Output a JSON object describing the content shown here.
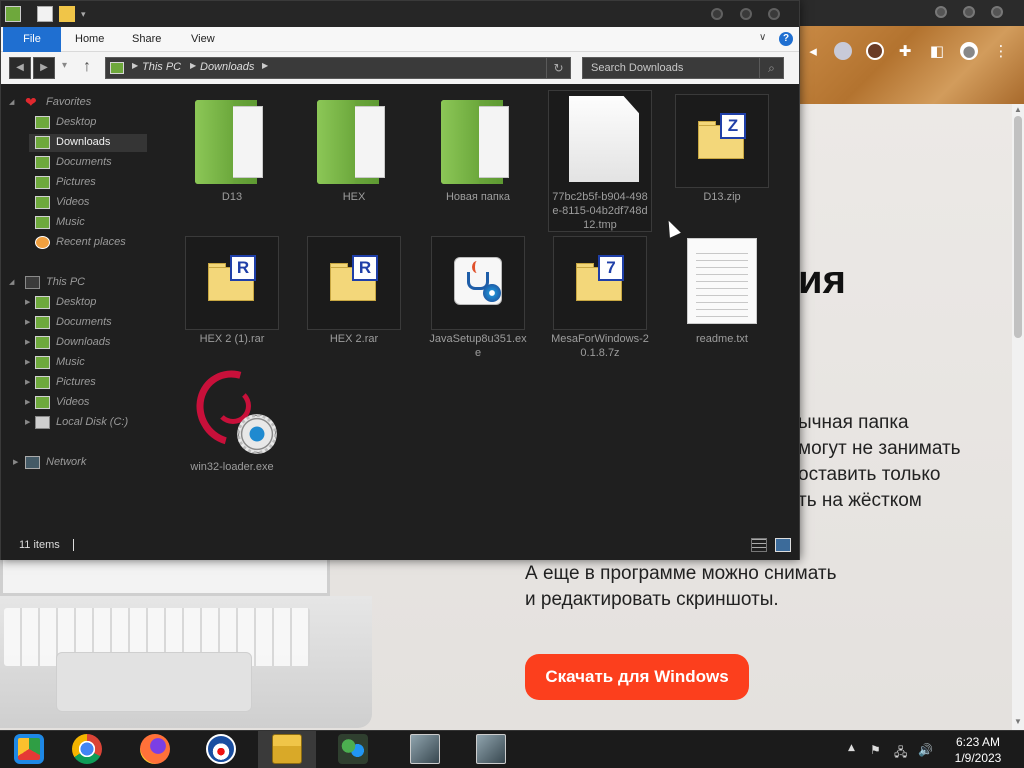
{
  "browser": {
    "heading_fragment": "ия",
    "paragraph_lines": [
      "ычная папка",
      "могут не занимать",
      "оставить только",
      "ть на жёстком"
    ],
    "paragraph2_lines": [
      "А еще в программе можно снимать",
      "и редактировать скриншоты."
    ],
    "download_button": "Скачать для Windows",
    "accent_color": "#fc3f1d"
  },
  "explorer": {
    "ribbon_tabs": [
      "File",
      "Home",
      "Share",
      "View"
    ],
    "address": {
      "crumbs": [
        "This PC",
        "Downloads"
      ]
    },
    "search": {
      "placeholder": "Search Downloads"
    },
    "sidebar": {
      "favorites_label": "Favorites",
      "favorites": [
        "Desktop",
        "Downloads",
        "Documents",
        "Pictures",
        "Videos",
        "Music",
        "Recent places"
      ],
      "thispc_label": "This PC",
      "thispc": [
        "Desktop",
        "Documents",
        "Downloads",
        "Music",
        "Pictures",
        "Videos",
        "Local Disk (C:)"
      ],
      "network_label": "Network",
      "active_item": "Downloads"
    },
    "files": [
      {
        "name": "D13",
        "type": "folder"
      },
      {
        "name": "HEX",
        "type": "folder"
      },
      {
        "name": "Новая папка",
        "type": "folder"
      },
      {
        "name": "77bc2b5f-b904-498e-8115-04b2df748d12.tmp",
        "type": "tmp"
      },
      {
        "name": "D13.zip",
        "type": "zip",
        "badge": "Z"
      },
      {
        "name": "HEX 2 (1).rar",
        "type": "rar",
        "badge": "R"
      },
      {
        "name": "HEX 2.rar",
        "type": "rar",
        "badge": "R"
      },
      {
        "name": "JavaSetup8u351.exe",
        "type": "exe-java"
      },
      {
        "name": "MesaForWindows-20.1.8.7z",
        "type": "7z",
        "badge": "7"
      },
      {
        "name": "readme.txt",
        "type": "txt"
      },
      {
        "name": "win32-loader.exe",
        "type": "exe-debian"
      }
    ],
    "status": {
      "item_count": "11 items"
    }
  },
  "taskbar": {
    "apps": [
      "chrome-old-icon",
      "chrome-icon",
      "firefox-icon",
      "obama-icon",
      "file-explorer-icon",
      "network-people-icon",
      "installer-icon",
      "installer2-icon"
    ],
    "clock": {
      "time": "6:23 AM",
      "date": "1/9/2023"
    }
  }
}
